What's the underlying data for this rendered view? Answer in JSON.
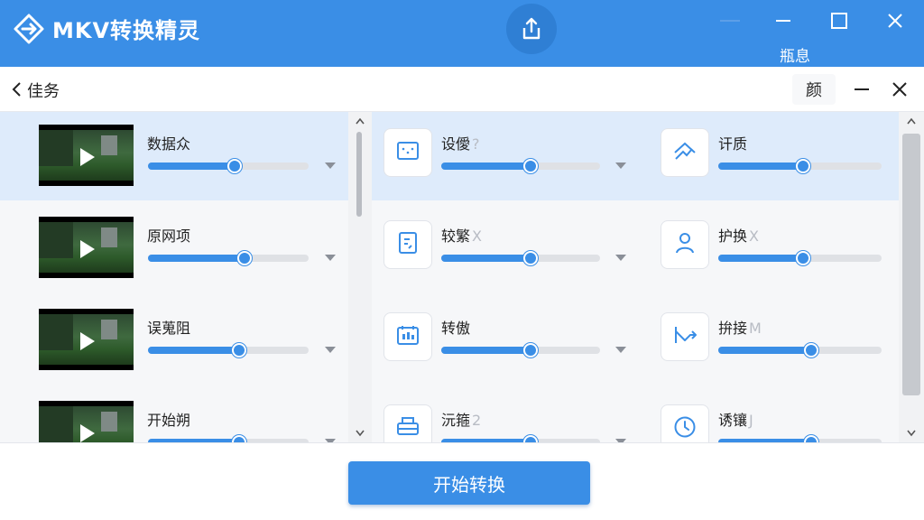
{
  "app": {
    "title": "MKV转换精灵",
    "notify_label": "瓶息"
  },
  "subheader": {
    "title": "佳务",
    "box_label": "颜"
  },
  "videos": [
    {
      "name": "数据众",
      "progress": 0.54,
      "selected": true
    },
    {
      "name": "原网项",
      "progress": 0.6,
      "selected": false
    },
    {
      "name": "误蒐阻",
      "progress": 0.57,
      "selected": false
    },
    {
      "name": "开始朔",
      "progress": 0.57,
      "selected": false
    }
  ],
  "options": [
    [
      {
        "name": "设僾",
        "ghost": "?",
        "icon": "screen-icon",
        "progress": 0.56
      },
      {
        "name": "讦质",
        "ghost": "",
        "icon": "route-icon",
        "progress": 0.52
      }
    ],
    [
      {
        "name": "较繁",
        "ghost": "X",
        "icon": "document-icon",
        "progress": 0.56
      },
      {
        "name": "护换",
        "ghost": "X",
        "icon": "user-icon",
        "progress": 0.52
      }
    ],
    [
      {
        "name": "转傲",
        "ghost": "",
        "icon": "calendar-icon",
        "progress": 0.56
      },
      {
        "name": "拚接",
        "ghost": "M",
        "icon": "arrow-path-icon",
        "progress": 0.57
      }
    ],
    [
      {
        "name": "沅箍",
        "ghost": "2",
        "icon": "printer-icon",
        "progress": 0.56
      },
      {
        "name": "诱镶",
        "ghost": "J",
        "icon": "clock-icon",
        "progress": 0.57
      }
    ]
  ],
  "actions": {
    "start_label": "开始转换"
  },
  "colors": {
    "accent": "#3a8ee6",
    "selected_row": "#deebfb",
    "track": "#dfe1e5"
  }
}
